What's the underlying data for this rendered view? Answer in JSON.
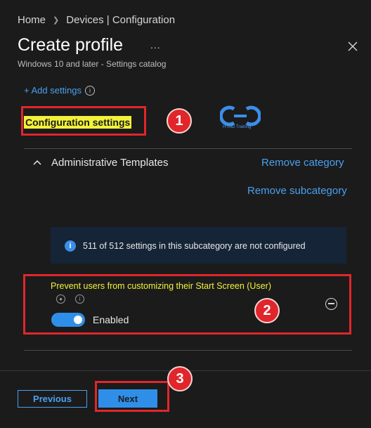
{
  "breadcrumb": {
    "home": "Home",
    "section": "Devices | Configuration"
  },
  "header": {
    "title": "Create profile",
    "more": "...",
    "subtitle": "Windows 10 and later - Settings catalog"
  },
  "add_settings": {
    "label": "+ Add settings"
  },
  "configuration": {
    "label": "Configuration settings"
  },
  "logo": {
    "text": "HTMD Training"
  },
  "category": {
    "label": "Administrative Templates",
    "remove_category": "Remove category",
    "remove_subcategory": "Remove subcategory"
  },
  "banner": {
    "text": "511 of 512 settings in this subcategory are not configured"
  },
  "setting": {
    "title": "Prevent users from customizing their Start Screen (User)",
    "toggle_state": "on",
    "value_label": "Enabled"
  },
  "footer": {
    "previous": "Previous",
    "next": "Next"
  },
  "annotations": [
    "1",
    "2",
    "3"
  ],
  "colors": {
    "accent": "#2f8fe8",
    "link": "#4aa0f0",
    "highlight": "#f2f23a",
    "callout": "#e0262b",
    "background": "#1b1b1b"
  }
}
